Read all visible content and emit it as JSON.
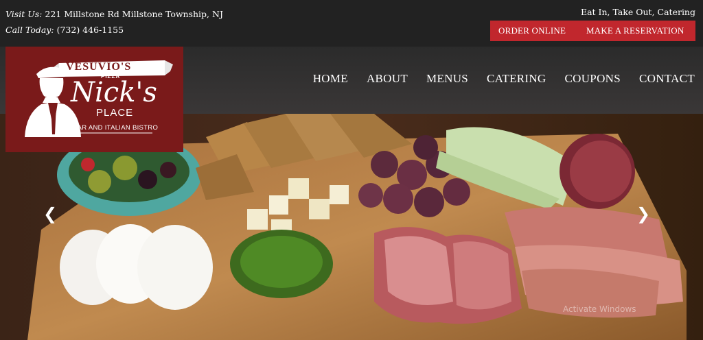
{
  "topbar": {
    "address_label": "Visit Us:",
    "address": "221 Millstone Rd Millstone Township, NJ",
    "phone_label": "Call Today:",
    "phone": "(732) 446-1155",
    "tagline": "Eat In, Take Out, Catering",
    "order_online": "ORDER ONLINE",
    "reservation": "MAKE A RESERVATION",
    "accent_color": "#c1272d"
  },
  "logo": {
    "banner": "VESUVIO'S",
    "pizza": "PIZZA",
    "name": "Nick's",
    "place": "PLACE",
    "subtitle": "BAR AND ITALIAN BISTRO",
    "background_color": "#7a1a1a"
  },
  "nav": {
    "items": [
      {
        "label": "HOME"
      },
      {
        "label": "ABOUT"
      },
      {
        "label": "MENUS"
      },
      {
        "label": "CATERING"
      },
      {
        "label": "COUPONS"
      },
      {
        "label": "CONTACT"
      }
    ]
  },
  "slider": {
    "prev_icon": "chevron-left-icon",
    "next_icon": "chevron-right-icon"
  },
  "watermark": "Activate Windows"
}
